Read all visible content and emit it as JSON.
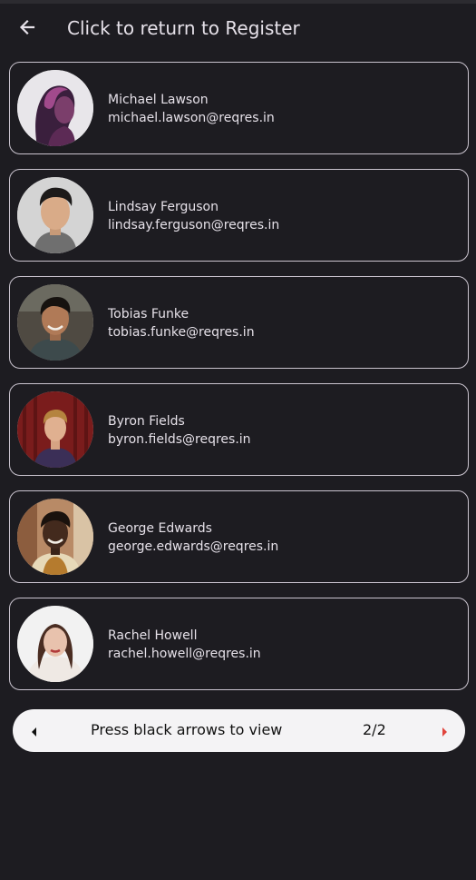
{
  "app_bar": {
    "back_icon": "arrow-left-icon",
    "title": "Click to return to Register"
  },
  "users": [
    {
      "name": "Michael Lawson",
      "email": "michael.lawson@reqres.in"
    },
    {
      "name": "Lindsay Ferguson",
      "email": "lindsay.ferguson@reqres.in"
    },
    {
      "name": "Tobias Funke",
      "email": "tobias.funke@reqres.in"
    },
    {
      "name": "Byron Fields",
      "email": "byron.fields@reqres.in"
    },
    {
      "name": "George Edwards",
      "email": "george.edwards@reqres.in"
    },
    {
      "name": "Rachel Howell",
      "email": "rachel.howell@reqres.in"
    }
  ],
  "pager": {
    "label": "Press black arrows to view",
    "page_indicator": "2/2",
    "prev_icon": "caret-left-icon",
    "next_icon": "caret-right-icon",
    "prev_color": "#111111",
    "next_color": "#e0443c"
  },
  "colors": {
    "background": "#1d1c21",
    "card_border": "#cac4cf",
    "text": "#e6e1e9",
    "pager_background": "#f4f3f5"
  }
}
